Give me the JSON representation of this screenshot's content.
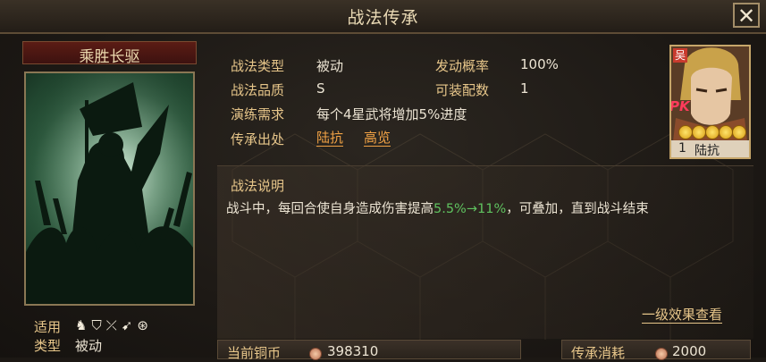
{
  "window": {
    "title": "战法传承",
    "close_label": "✕"
  },
  "skill": {
    "name": "乘胜长驱",
    "usable_label": "适用",
    "type_label": "类型",
    "type_value": "被动"
  },
  "info": {
    "type_label": "战法类型",
    "type_value": "被动",
    "trigger_label": "发动概率",
    "trigger_value": "100%",
    "quality_label": "战法品质",
    "quality_value": "S",
    "slots_label": "可装配数",
    "slots_value": "1",
    "train_label": "演练需求",
    "train_value": "每个4星武将增加5%进度",
    "source_label": "传承出处",
    "source_1": "陆抗",
    "source_2": "高览"
  },
  "general": {
    "faction": "吴",
    "tag": "PK",
    "cost": "1",
    "name": "陆抗",
    "stars": 5
  },
  "description": {
    "heading": "战法说明",
    "text_prefix": "战斗中，每回合使自身造成伤害提高",
    "text_highlight": "5.5%→11%",
    "text_suffix": "，可叠加，直到战斗结束"
  },
  "level_effects_link": "一级效果查看",
  "bottom": {
    "coin_label": "当前铜币",
    "coin_value": "398310",
    "cost_label": "传承消耗",
    "cost_value": "2000"
  },
  "colors": {
    "label": "#e7c68a",
    "value": "#ece4d3",
    "link": "#f1a245",
    "highlight": "#5fc25f"
  }
}
